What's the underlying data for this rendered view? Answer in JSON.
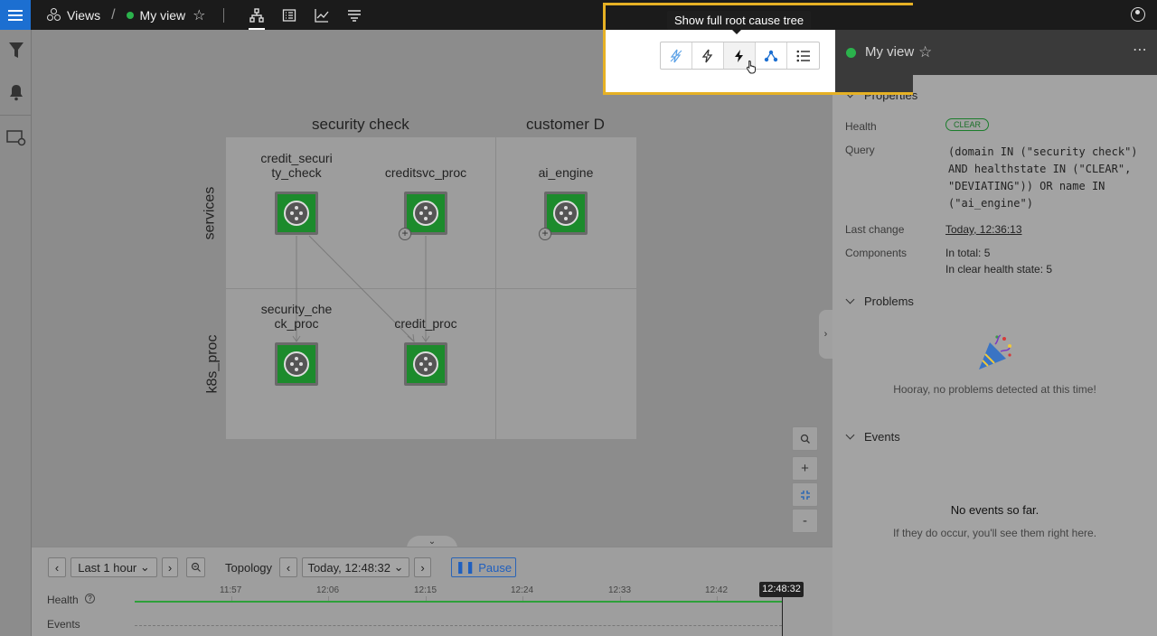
{
  "topbar": {
    "views_label": "Views",
    "view_name": "My view"
  },
  "canvas": {
    "columns": [
      "security check",
      "customer D"
    ],
    "rows": [
      "services",
      "k8s_proc"
    ],
    "nodes": [
      {
        "label": "credit_securi\nty_check"
      },
      {
        "label": "creditsvc_proc"
      },
      {
        "label": "ai_engine"
      },
      {
        "label": "security_che\nck_proc"
      },
      {
        "label": "credit_proc"
      }
    ],
    "zoom": {
      "search": "search",
      "in": "+",
      "fit": "fit",
      "out": "-"
    }
  },
  "timeline": {
    "range": "Last 1 hour",
    "mode_label": "Topology",
    "timestamp": "Today, 12:48:32",
    "pause_label": "Pause",
    "health_label": "Health",
    "events_label": "Events",
    "ticks": [
      "11:57",
      "12:06",
      "12:15",
      "12:24",
      "12:33",
      "12:42"
    ],
    "now": "12:48:32"
  },
  "panel": {
    "title": "My view",
    "properties_label": "Properties",
    "health_key": "Health",
    "health_value": "CLEAR",
    "query_key": "Query",
    "query_value": "(domain IN (\"security check\") AND healthstate IN (\"CLEAR\", \"DEVIATING\")) OR name IN (\"ai_engine\")",
    "last_change_key": "Last change",
    "last_change_value": "Today, 12:36:13",
    "components_key": "Components",
    "components_total": "In total: 5",
    "components_clear": "In clear health state: 5",
    "problems_label": "Problems",
    "problems_empty": "Hooray, no problems detected at this time!",
    "events_label": "Events",
    "events_empty_title": "No events so far.",
    "events_empty_sub": "If they do occur, you'll see them right here."
  },
  "tooltip": "Show full root cause tree",
  "colors": {
    "accent": "#1c6fd1",
    "health_clear": "#2bb24c",
    "highlight": "#e6b124"
  }
}
